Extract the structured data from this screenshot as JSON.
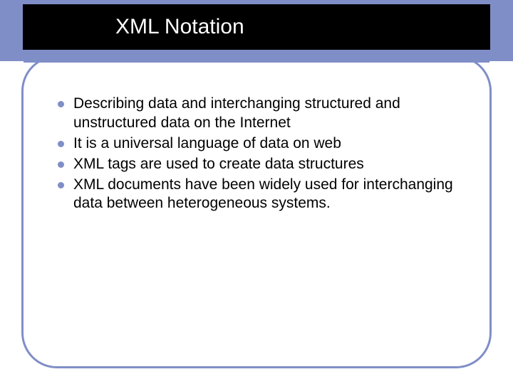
{
  "title": "XML Notation",
  "bullets": [
    "Describing data and interchanging structured and unstructured data on the Internet",
    "It is a universal language of data on web",
    "XML tags are used to create data structures",
    "XML documents have been widely used for interchanging data between heterogeneous systems."
  ]
}
